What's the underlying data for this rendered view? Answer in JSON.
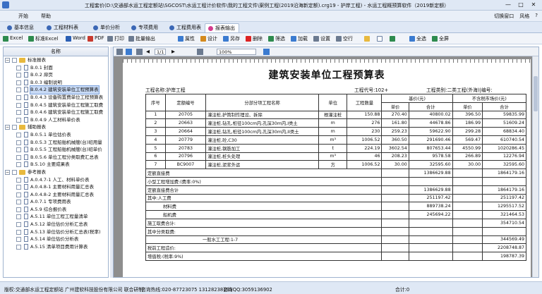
{
  "window": {
    "title": "工程套价(D:\\交通部水运工程定额站\\SGCOST\\水运工程计价软件\\我的工程文件\\案例工程(2019沿海新定额).crg19 - 护岸工程) - 水运工程概预算软件（2019新定额）",
    "controls": [
      "—",
      "□",
      "✕"
    ]
  },
  "menubar": {
    "items": [
      "开始",
      "帮助"
    ],
    "right_items": [
      "切换窗口",
      "风格",
      "?"
    ]
  },
  "tabs": [
    {
      "label": "基本信息",
      "active": false
    },
    {
      "label": "工程材料表",
      "active": false
    },
    {
      "label": "单价分析",
      "active": false
    },
    {
      "label": "专项费用",
      "active": false
    },
    {
      "label": "工程费用表",
      "active": false
    },
    {
      "label": "报表输出",
      "active": true
    }
  ],
  "toolbar": {
    "items": [
      "Excel",
      "标准Excel",
      "Word",
      "PDF",
      "打印",
      "批量输出",
      "属性",
      "设计",
      "另存",
      "删除",
      "筛选",
      "加载",
      "设置",
      "空行",
      "",
      "",
      "",
      "全选",
      "全屏"
    ]
  },
  "sidebar": {
    "header": "名称",
    "items": [
      {
        "label": "标准报表",
        "level": 0,
        "type": "folder",
        "selected": false
      },
      {
        "label": "B.0.1 封面",
        "level": 1,
        "type": "doc",
        "selected": false
      },
      {
        "label": "B.0.2 扉页",
        "level": 1,
        "type": "doc",
        "selected": false
      },
      {
        "label": "B.0.3 编制说明",
        "level": 1,
        "type": "doc",
        "selected": false
      },
      {
        "label": "B.0.4.2 建筑安装单位工程预算表",
        "level": 1,
        "type": "doc",
        "selected": true
      },
      {
        "label": "B.0.4.3 设备购置费单位工程预算表",
        "level": 1,
        "type": "doc",
        "selected": false
      },
      {
        "label": "B.0.4.5 建筑安装单位工程施工取费",
        "level": 1,
        "type": "doc",
        "selected": false
      },
      {
        "label": "B.0.4.6 建筑安装单位工程施工取费",
        "level": 1,
        "type": "doc",
        "selected": false
      },
      {
        "label": "B.0.4.9 人工材料单价表",
        "level": 1,
        "type": "doc",
        "selected": false
      },
      {
        "label": "辅助报表",
        "level": 0,
        "type": "folder",
        "selected": false
      },
      {
        "label": "B.0.5.1 单位估价表",
        "level": 1,
        "type": "doc",
        "selected": false
      },
      {
        "label": "B.0.5.3 工程船舶机械艘(台)班用量",
        "level": 1,
        "type": "doc",
        "selected": false
      },
      {
        "label": "B.0.5.5 工程船舶机械艘(台)班单价",
        "level": 1,
        "type": "doc",
        "selected": false
      },
      {
        "label": "B.0.5.6 单位工程分类取费汇总表",
        "level": 1,
        "type": "doc",
        "selected": false
      },
      {
        "label": "B.5.10 主要成果表",
        "level": 1,
        "type": "doc",
        "selected": false
      },
      {
        "label": "参考报表",
        "level": 0,
        "type": "folder",
        "selected": false
      },
      {
        "label": "A.0.4.7-1 人工、材料单价表",
        "level": 1,
        "type": "doc",
        "selected": false
      },
      {
        "label": "A.0.4.8-1 主要材料用量汇总表",
        "level": 1,
        "type": "doc",
        "selected": false
      },
      {
        "label": "A.0.4.8-2 主要材料用量汇总表",
        "level": 1,
        "type": "doc",
        "selected": false
      },
      {
        "label": "A.0.7.1 专项费用表",
        "level": 1,
        "type": "doc",
        "selected": false
      },
      {
        "label": "A.5.9 综合报价表",
        "level": 1,
        "type": "doc",
        "selected": false
      },
      {
        "label": "A.5.11 单位工程工程量清单",
        "level": 1,
        "type": "doc",
        "selected": false
      },
      {
        "label": "A.5.12 单位估价分析汇总表",
        "level": 1,
        "type": "doc",
        "selected": false
      },
      {
        "label": "A.5.13 单位估价分析汇总表(税率)",
        "level": 1,
        "type": "doc",
        "selected": false
      },
      {
        "label": "A.5.14 单位估价分析表",
        "level": 1,
        "type": "doc",
        "selected": false
      },
      {
        "label": "A.5.15 清单项目费用计算表",
        "level": 1,
        "type": "doc",
        "selected": false
      }
    ]
  },
  "viewer": {
    "page": "1/1",
    "zoom": "100%"
  },
  "report": {
    "title": "建筑安装单位工程预算表",
    "project_name": "工程名称:护岸工程",
    "project_code": "工程代号:102+",
    "project_type": "工程类别:二类工程(外海)|编号:",
    "headers": {
      "index": "序号",
      "quota_no": "定额编号",
      "item_name": "分部分项工程名称",
      "unit": "单位",
      "quantity": "工程数量",
      "base_price": "基价(元)",
      "market_price": "不含税市场价(元)",
      "unit_price": "单价",
      "total": "合计"
    },
    "rows": [
      {
        "index": "1",
        "code": "20705",
        "name": "灌注桩,护筒制作埋设、拆除",
        "unit": "根灌注桩",
        "qty": "150.88",
        "bp_unit": "270.40",
        "bp_total": "40800.02",
        "mp_unit": "396.50",
        "mp_total": "59835.99"
      },
      {
        "index": "2",
        "code": "20663",
        "name": "灌注桩,钻孔,桩径100cm内,孔深30m内,I类土",
        "unit": "m",
        "qty": "276",
        "bp_unit": "161.80",
        "bp_total": "44678.86",
        "mp_unit": "186.99",
        "mp_total": "51609.24"
      },
      {
        "index": "3",
        "code": "20664",
        "name": "灌注桩,钻孔,桩径100cm内,孔深30m内,II类土",
        "unit": "m",
        "qty": "230",
        "bp_unit": "259.23",
        "bp_total": "59622.90",
        "mp_unit": "299.28",
        "mp_total": "68834.40"
      },
      {
        "index": "4",
        "code": "20779",
        "name": "灌注桩,砼,C30",
        "unit": "m³",
        "qty": "1006.52",
        "bp_unit": "360.50",
        "bp_total": "291690.46",
        "mp_unit": "569.47",
        "mp_total": "610740.54"
      },
      {
        "index": "5",
        "code": "20783",
        "name": "灌注桩,钢筋加工",
        "unit": "t",
        "qty": "224.19",
        "bp_unit": "3602.54",
        "bp_total": "807653.44",
        "mp_unit": "4550.99",
        "mp_total": "1020286.45"
      },
      {
        "index": "6",
        "code": "20796",
        "name": "灌注桩,桩头处理",
        "unit": "m³",
        "qty": "46",
        "bp_unit": "208.23",
        "bp_total": "9578.58",
        "mp_unit": "266.89",
        "mp_total": "12276.94"
      },
      {
        "index": "7",
        "code": "BC9007",
        "name": "灌注桩,泥浆外运",
        "unit": "方",
        "qty": "1006.52",
        "bp_unit": "30.00",
        "bp_total": "32595.60",
        "mp_unit": "30.00",
        "mp_total": "32595.60"
      }
    ],
    "summary": [
      {
        "label": "定额直接费",
        "bp_total": "1386629.88",
        "mp_total": "1864179.16"
      },
      {
        "label": "小型工程增加费:(费率:0%)",
        "bp_total": "",
        "mp_total": ""
      },
      {
        "label": "定额直接费合计",
        "bp_total": "1386629.88",
        "mp_total": "1864179.16"
      },
      {
        "label": "其中:人工费",
        "bp_total": "251197.42",
        "mp_total": "251197.42"
      },
      {
        "label": "材料费",
        "bp_total": "889738.24",
        "mp_total": "1295517.52"
      },
      {
        "label": "船机费",
        "bp_total": "245694.22",
        "mp_total": "321464.53"
      },
      {
        "label": "施工取费合计:",
        "bp_total": "",
        "mp_total": "354710.54"
      },
      {
        "label": "其中分类取费:",
        "bp_total": "",
        "mp_total": ""
      },
      {
        "label": "一般水工工程:1-7",
        "bp_total": "",
        "mp_total": "344569.49"
      },
      {
        "label": "税前工程造价:",
        "bp_total": "",
        "mp_total": "2208748.87"
      },
      {
        "label": "增值税:(税率:9%)",
        "bp_total": "",
        "mp_total": "198787.39"
      }
    ]
  },
  "statusbar": {
    "company": "版权:交通部水运工程定额站  广州建软科技股份有限公司  联合研制",
    "hotline": "咨询热线:020-87723075  13128238195",
    "qq": "咨询QQ:3059136902",
    "total": "合计:0"
  }
}
